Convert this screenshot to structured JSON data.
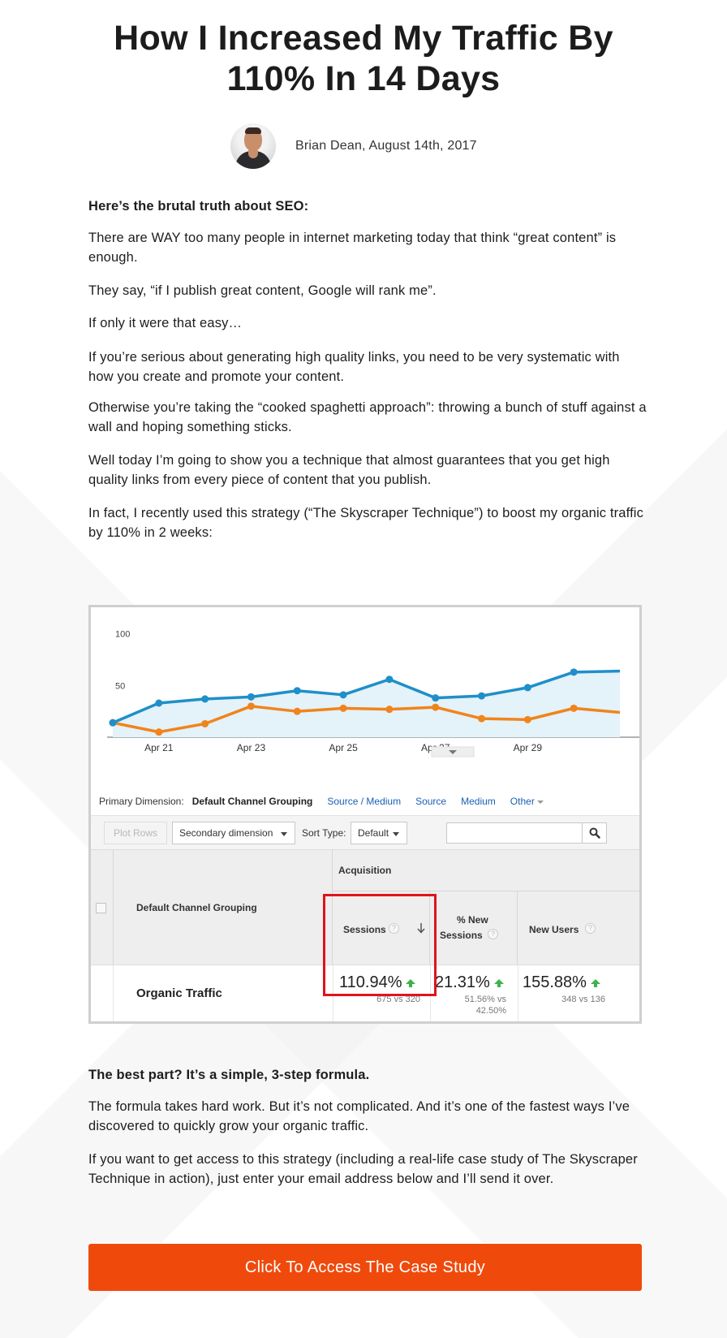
{
  "article": {
    "title": "How I Increased My Traffic By 110% In 14 Days",
    "byline": "Brian Dean, August 14th, 2017",
    "intro_heading": "Here’s the brutal truth about SEO:",
    "p1": "There are WAY too many people in internet marketing today that think “great content” is enough.",
    "p2": "They say, “if I publish great content, Google will rank me”.",
    "p3": "If only it were that easy…",
    "p4": "If you’re serious about generating high quality links, you need to be very systematic with how you create and promote your content.",
    "p5": "Otherwise you’re taking the “cooked spaghetti approach”: throwing a bunch of stuff against a wall and hoping something sticks.",
    "p6": "Well today I’m going to show you a technique that almost guarantees that you get high quality links from every piece of content that you publish.",
    "p7": "In fact, I recently used this strategy (“The Skyscraper Technique”) to boost my organic traffic by 110% in 2 weeks:",
    "best_heading": "The best part? It’s a simple, 3-step formula.",
    "p8": "The formula takes hard work. But it’s not complicated. And it’s one of the fastest ways I’ve discovered to quickly grow your organic traffic.",
    "p9": "If you want to get access to this strategy (including a real-life case study of The Skyscraper Technique in action), just enter your email address below and I’ll send it over.",
    "cta_label": "Click To Access The Case Study"
  },
  "analytics": {
    "primary_dimension_label": "Primary Dimension:",
    "dimensions": {
      "active": "Default Channel Grouping",
      "source_medium": "Source / Medium",
      "source": "Source",
      "medium": "Medium",
      "other": "Other"
    },
    "plot_rows": "Plot Rows",
    "secondary_dimension": "Secondary dimension",
    "sort_type_label": "Sort Type:",
    "sort_type_value": "Default",
    "table": {
      "dimension_header": "Default Channel Grouping",
      "group_header": "Acquisition",
      "col_sessions": "Sessions",
      "col_new_sessions_1": "% New",
      "col_new_sessions_2": "Sessions",
      "col_new_users": "New Users",
      "help": "?",
      "row_label": "Organic Traffic",
      "sessions_value": "110.94%",
      "sessions_sub": "675 vs 320",
      "new_sessions_value": "21.31%",
      "new_sessions_sub_1": "51.56% vs",
      "new_sessions_sub_2": "42.50%",
      "new_users_value": "155.88%",
      "new_users_sub": "348 vs 136"
    },
    "colors": {
      "current_series": "#1f8fc9",
      "previous_series": "#f0841c",
      "highlight": "#e0141b",
      "up_arrow": "#3cb44a"
    }
  },
  "chart_data": {
    "type": "line",
    "x": [
      "Apr 20",
      "Apr 21",
      "Apr 22",
      "Apr 23",
      "Apr 24",
      "Apr 25",
      "Apr 26",
      "Apr 27",
      "Apr 28",
      "Apr 29",
      "Apr 30",
      "May 1"
    ],
    "x_tick_labels": [
      "Apr 21",
      "Apr 23",
      "Apr 25",
      "Apr 27",
      "Apr 29"
    ],
    "y_tick_labels": [
      "100",
      "50"
    ],
    "ylim": [
      0,
      110
    ],
    "series": [
      {
        "values": [
          14,
          33,
          37,
          39,
          45,
          41,
          56,
          38,
          40,
          48,
          63,
          64
        ]
      },
      {
        "values": [
          14,
          5,
          13,
          30,
          25,
          28,
          27,
          29,
          18,
          17,
          28,
          24
        ]
      }
    ],
    "grid": false,
    "legend": "none"
  }
}
